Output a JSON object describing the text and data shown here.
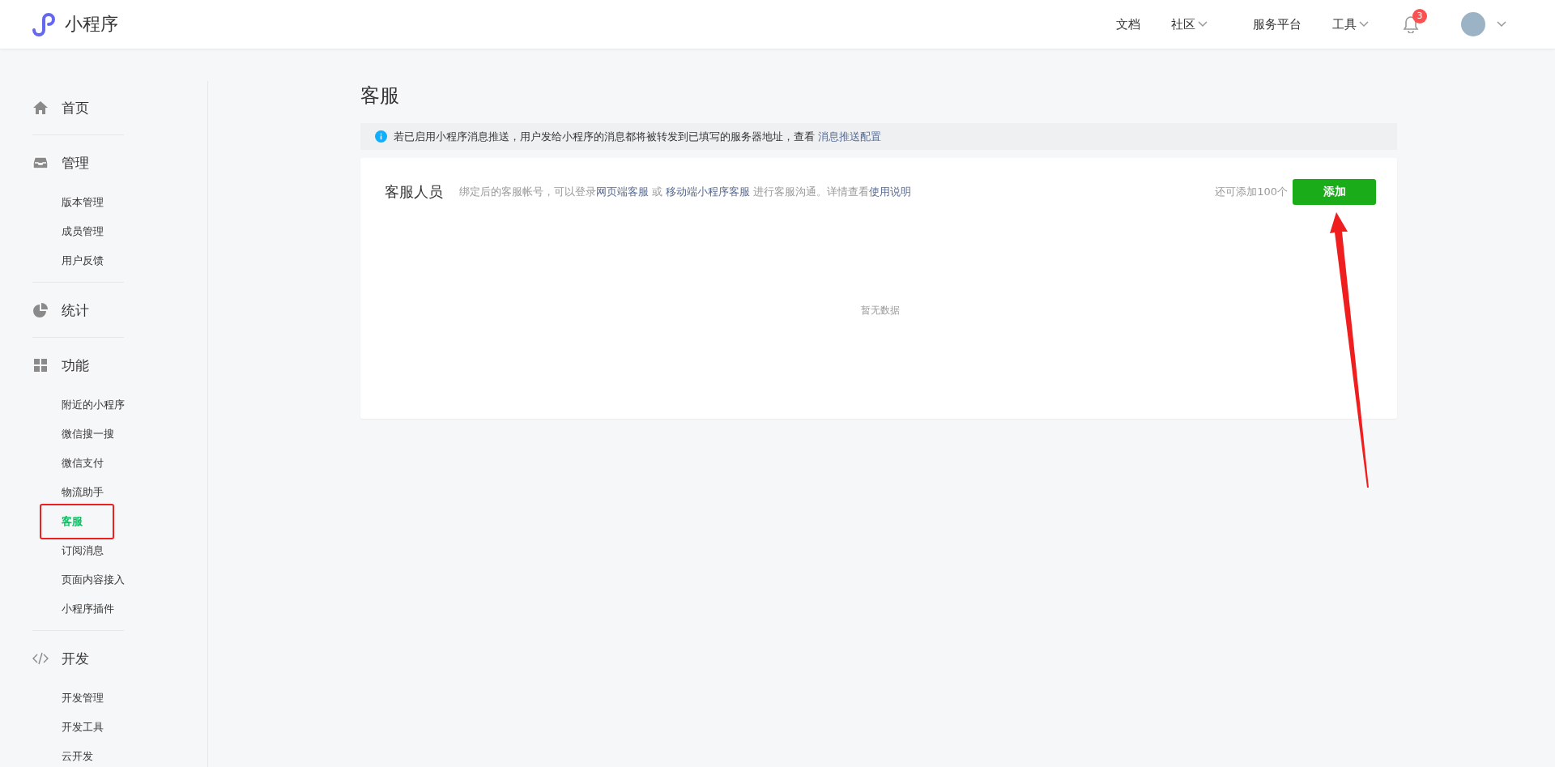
{
  "header": {
    "logo_text": "小程序",
    "nav": [
      {
        "label": "文档",
        "dropdown": false
      },
      {
        "label": "社区",
        "dropdown": true
      },
      {
        "label": "服务平台",
        "dropdown": false
      },
      {
        "label": "工具",
        "dropdown": true
      }
    ],
    "notifications": {
      "badge": "3"
    },
    "account": {
      "dropdown": true
    }
  },
  "sidebar": {
    "sections": [
      {
        "label": "首页"
      },
      {
        "label": "管理",
        "items": [
          {
            "label": "版本管理",
            "selected": false
          },
          {
            "label": "成员管理",
            "selected": false
          },
          {
            "label": "用户反馈",
            "selected": false
          }
        ]
      },
      {
        "label": "统计"
      },
      {
        "label": "功能",
        "items": [
          {
            "label": "附近的小程序",
            "selected": false
          },
          {
            "label": "微信搜一搜",
            "selected": false
          },
          {
            "label": "微信支付",
            "selected": false
          },
          {
            "label": "物流助手",
            "selected": false
          },
          {
            "label": "客服",
            "selected": true
          },
          {
            "label": "订阅消息",
            "selected": false
          },
          {
            "label": "页面内容接入",
            "selected": false
          },
          {
            "label": "小程序插件",
            "selected": false
          }
        ]
      },
      {
        "label": "开发",
        "items": [
          {
            "label": "开发管理",
            "selected": false
          },
          {
            "label": "开发工具",
            "selected": false
          },
          {
            "label": "云开发",
            "selected": false
          }
        ]
      }
    ]
  },
  "page_title": "客服",
  "notice": {
    "text": "若已启用小程序消息推送，用户发给小程序的消息都将被转发到已填写的服务器地址，查看",
    "link": "消息推送配置"
  },
  "card": {
    "title": "客服人员",
    "description": [
      {
        "kind": "text",
        "text": "绑定后的客服帐号，可以登录"
      },
      {
        "kind": "link",
        "text": "网页端客服"
      },
      {
        "kind": "text",
        "text": " 或 "
      },
      {
        "kind": "link",
        "text": "移动端小程序客服"
      },
      {
        "kind": "text",
        "text": " 进行客服沟通。详情查看"
      },
      {
        "kind": "link",
        "text": "使用说明"
      }
    ],
    "remaining": "还可添加100个",
    "add_button": "添加",
    "empty_text": "暂无数据"
  }
}
